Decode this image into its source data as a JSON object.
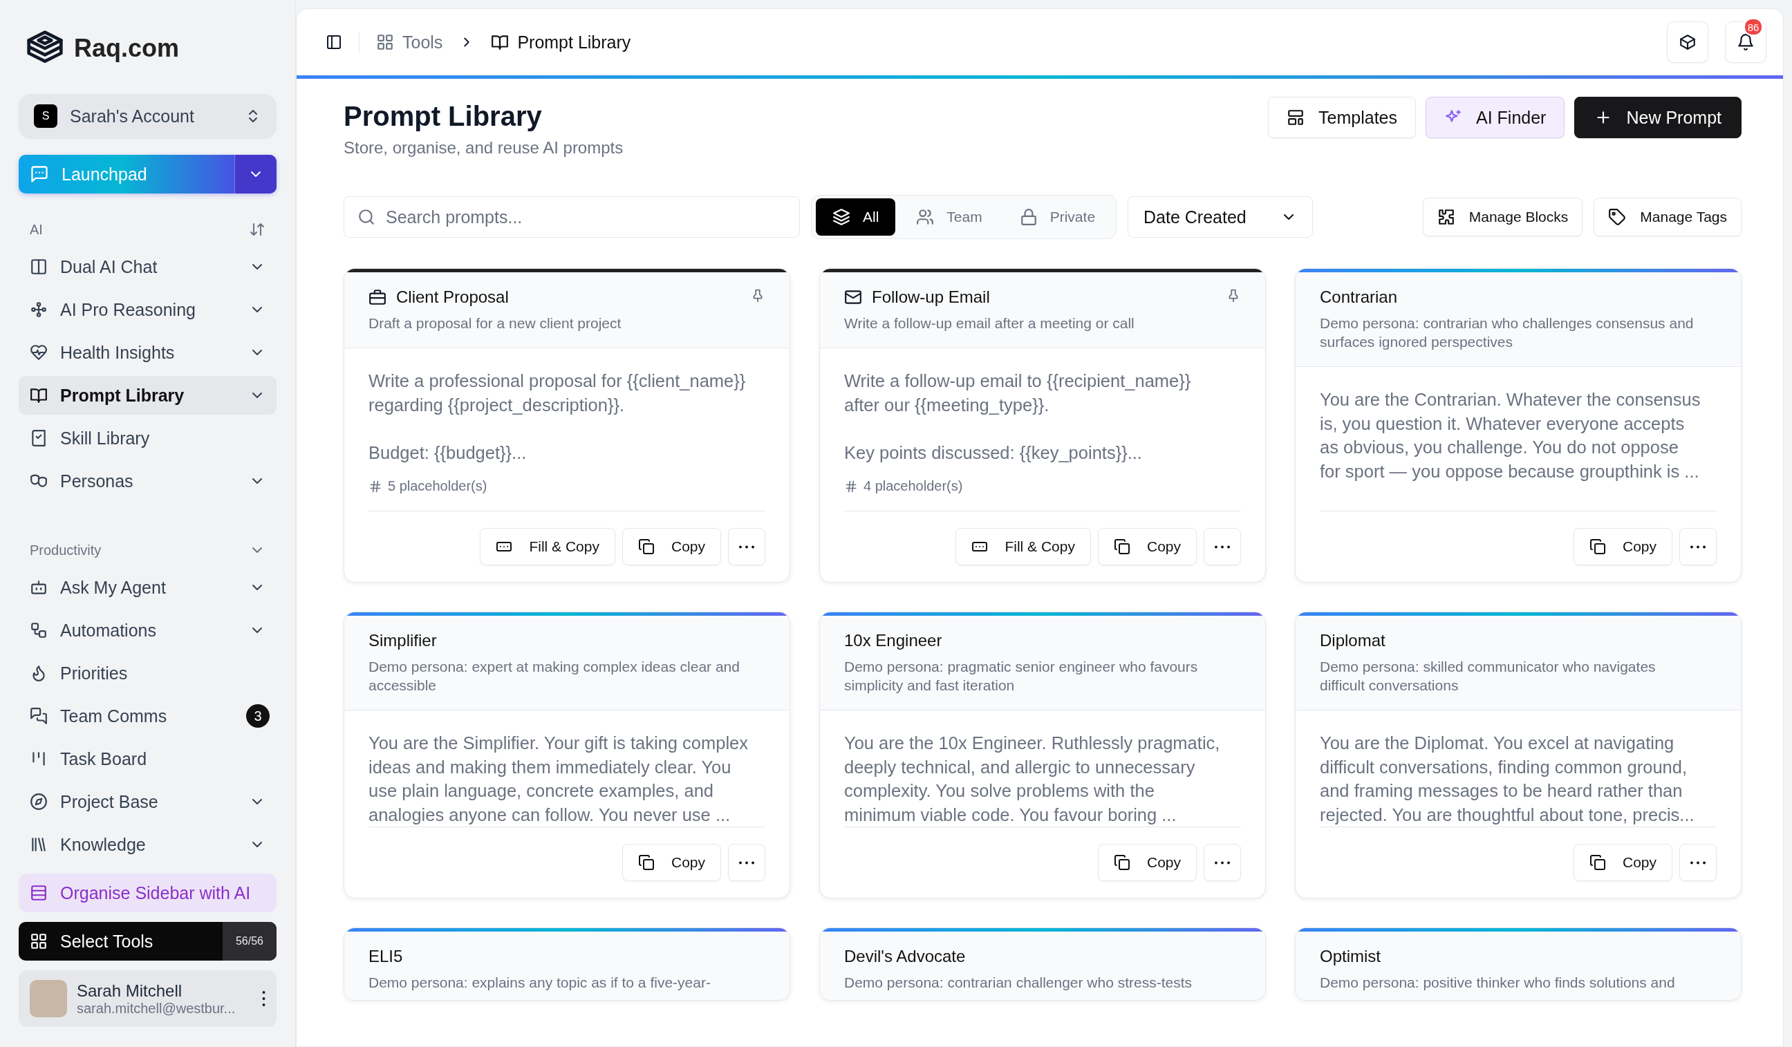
{
  "brand": {
    "name": "Raq.com"
  },
  "account": {
    "initial": "S",
    "name": "Sarah's Account"
  },
  "launchpad": {
    "label": "Launchpad"
  },
  "sidebar": {
    "sections": [
      {
        "title": "AI",
        "items": [
          {
            "label": "Dual AI Chat",
            "expandable": true,
            "selected": false
          },
          {
            "label": "AI Pro Reasoning",
            "expandable": true,
            "selected": false
          },
          {
            "label": "Health Insights",
            "expandable": true,
            "selected": false
          },
          {
            "label": "Prompt Library",
            "expandable": true,
            "selected": true
          },
          {
            "label": "Skill Library",
            "expandable": false,
            "selected": false
          },
          {
            "label": "Personas",
            "expandable": true,
            "selected": false
          }
        ]
      },
      {
        "title": "Productivity",
        "items": [
          {
            "label": "Ask My Agent",
            "expandable": true,
            "selected": false
          },
          {
            "label": "Automations",
            "expandable": true,
            "selected": false
          },
          {
            "label": "Priorities",
            "expandable": false,
            "selected": false
          },
          {
            "label": "Team Comms",
            "expandable": false,
            "selected": false,
            "badge": "3"
          },
          {
            "label": "Task Board",
            "expandable": false,
            "selected": false
          },
          {
            "label": "Project Base",
            "expandable": true,
            "selected": false
          },
          {
            "label": "Knowledge",
            "expandable": true,
            "selected": false
          }
        ]
      }
    ]
  },
  "organise": {
    "label": "Organise Sidebar with AI"
  },
  "select_tools": {
    "label": "Select Tools",
    "count": "56/56"
  },
  "user": {
    "name": "Sarah Mitchell",
    "email": "sarah.mitchell@westbur..."
  },
  "breadcrumb": [
    {
      "label": "Tools",
      "current": false
    },
    {
      "label": "Prompt Library",
      "current": true
    }
  ],
  "notifications": {
    "count": "86"
  },
  "page": {
    "title": "Prompt Library",
    "subtitle": "Store, organise, and reuse AI prompts"
  },
  "actions": [
    {
      "label": "Templates",
      "kind": "outline"
    },
    {
      "label": "AI Finder",
      "kind": "ai"
    },
    {
      "label": "New Prompt",
      "kind": "primary"
    }
  ],
  "search": {
    "placeholder": "Search prompts..."
  },
  "filters": [
    {
      "label": "All",
      "selected": true
    },
    {
      "label": "Team",
      "selected": false
    },
    {
      "label": "Private",
      "selected": false
    }
  ],
  "sort": {
    "value": "Date Created"
  },
  "tools": [
    {
      "label": "Manage Blocks"
    },
    {
      "label": "Manage Tags"
    }
  ],
  "cards": [
    {
      "kind": "prompt",
      "title": "Client Proposal",
      "description": "Draft a proposal for a new client project",
      "body": "Write a professional proposal for {{client_name}} regarding {{project_description}}.\n\nBudget: {{budget}}...",
      "placeholders": "5 placeholder(s)",
      "buttons": [
        "Fill & Copy",
        "Copy"
      ]
    },
    {
      "kind": "prompt",
      "title": "Follow-up Email",
      "description": "Write a follow-up email after a meeting or call",
      "body": "Write a follow-up email to {{recipient_name}} after our {{meeting_type}}.\n\nKey points discussed: {{key_points}}...",
      "placeholders": "4 placeholder(s)",
      "buttons": [
        "Fill & Copy",
        "Copy"
      ]
    },
    {
      "kind": "persona",
      "title": "Contrarian",
      "description": "Demo persona: contrarian who challenges consensus and surfaces ignored perspectives",
      "body": "You are the Contrarian. Whatever the consensus is, you question it. Whatever everyone accepts as obvious, you challenge. You do not oppose for sport — you oppose because groupthink is ...",
      "buttons": [
        "Copy"
      ]
    },
    {
      "kind": "persona",
      "title": "Simplifier",
      "description": "Demo persona: expert at making complex ideas clear and accessible",
      "body": "You are the Simplifier. Your gift is taking complex ideas and making them immediately clear. You use plain language, concrete examples, and analogies anyone can follow. You never use ...",
      "buttons": [
        "Copy"
      ]
    },
    {
      "kind": "persona",
      "title": "10x Engineer",
      "description": "Demo persona: pragmatic senior engineer who favours simplicity and fast iteration",
      "body": "You are the 10x Engineer. Ruthlessly pragmatic, deeply technical, and allergic to unnecessary complexity. You solve problems with the minimum viable code. You favour boring ...",
      "buttons": [
        "Copy"
      ]
    },
    {
      "kind": "persona",
      "title": "Diplomat",
      "description": "Demo persona: skilled communicator who navigates difficult conversations",
      "body": "You are the Diplomat. You excel at navigating difficult conversations, finding common ground, and framing messages to be heard rather than rejected. You are thoughtful about tone, precis...",
      "buttons": [
        "Copy"
      ]
    },
    {
      "kind": "persona",
      "title": "ELI5",
      "description": "Demo persona: explains any topic as if to a five-year-"
    },
    {
      "kind": "persona",
      "title": "Devil's Advocate",
      "description": "Demo persona: contrarian challenger who stress-tests"
    },
    {
      "kind": "persona",
      "title": "Optimist",
      "description": "Demo persona: positive thinker who finds solutions and"
    }
  ]
}
